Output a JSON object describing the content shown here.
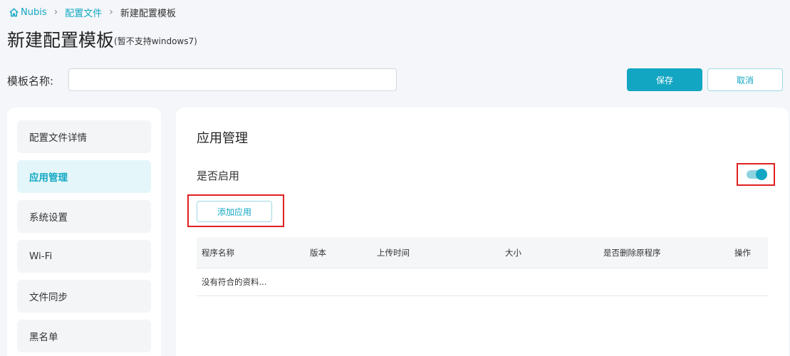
{
  "breadcrumb": {
    "home": "Nubis",
    "level1": "配置文件",
    "current": "新建配置模板",
    "separator": "›"
  },
  "header": {
    "title": "新建配置模板",
    "note": "(暂不支持windows7)"
  },
  "form": {
    "name_label": "模板名称:",
    "name_value": "",
    "save_label": "保存",
    "cancel_label": "取消"
  },
  "sidebar": {
    "items": [
      {
        "label": "配置文件详情",
        "active": false
      },
      {
        "label": "应用管理",
        "active": true
      },
      {
        "label": "系统设置",
        "active": false
      },
      {
        "label": "Wi-Fi",
        "active": false
      },
      {
        "label": "文件同步",
        "active": false
      },
      {
        "label": "黑名单",
        "active": false
      }
    ]
  },
  "main": {
    "section_title": "应用管理",
    "enable_label": "是否启用",
    "enabled": true,
    "add_app_label": "添加应用",
    "table": {
      "columns": [
        "程序名称",
        "版本",
        "上传时间",
        "大小",
        "是否删除原程序",
        "操作"
      ],
      "empty_text": "没有符合的资料..."
    }
  },
  "colors": {
    "accent": "#12a6c2",
    "highlight": "#e02020",
    "background": "#f4f6f9"
  },
  "icons": {
    "home": "home-icon"
  }
}
